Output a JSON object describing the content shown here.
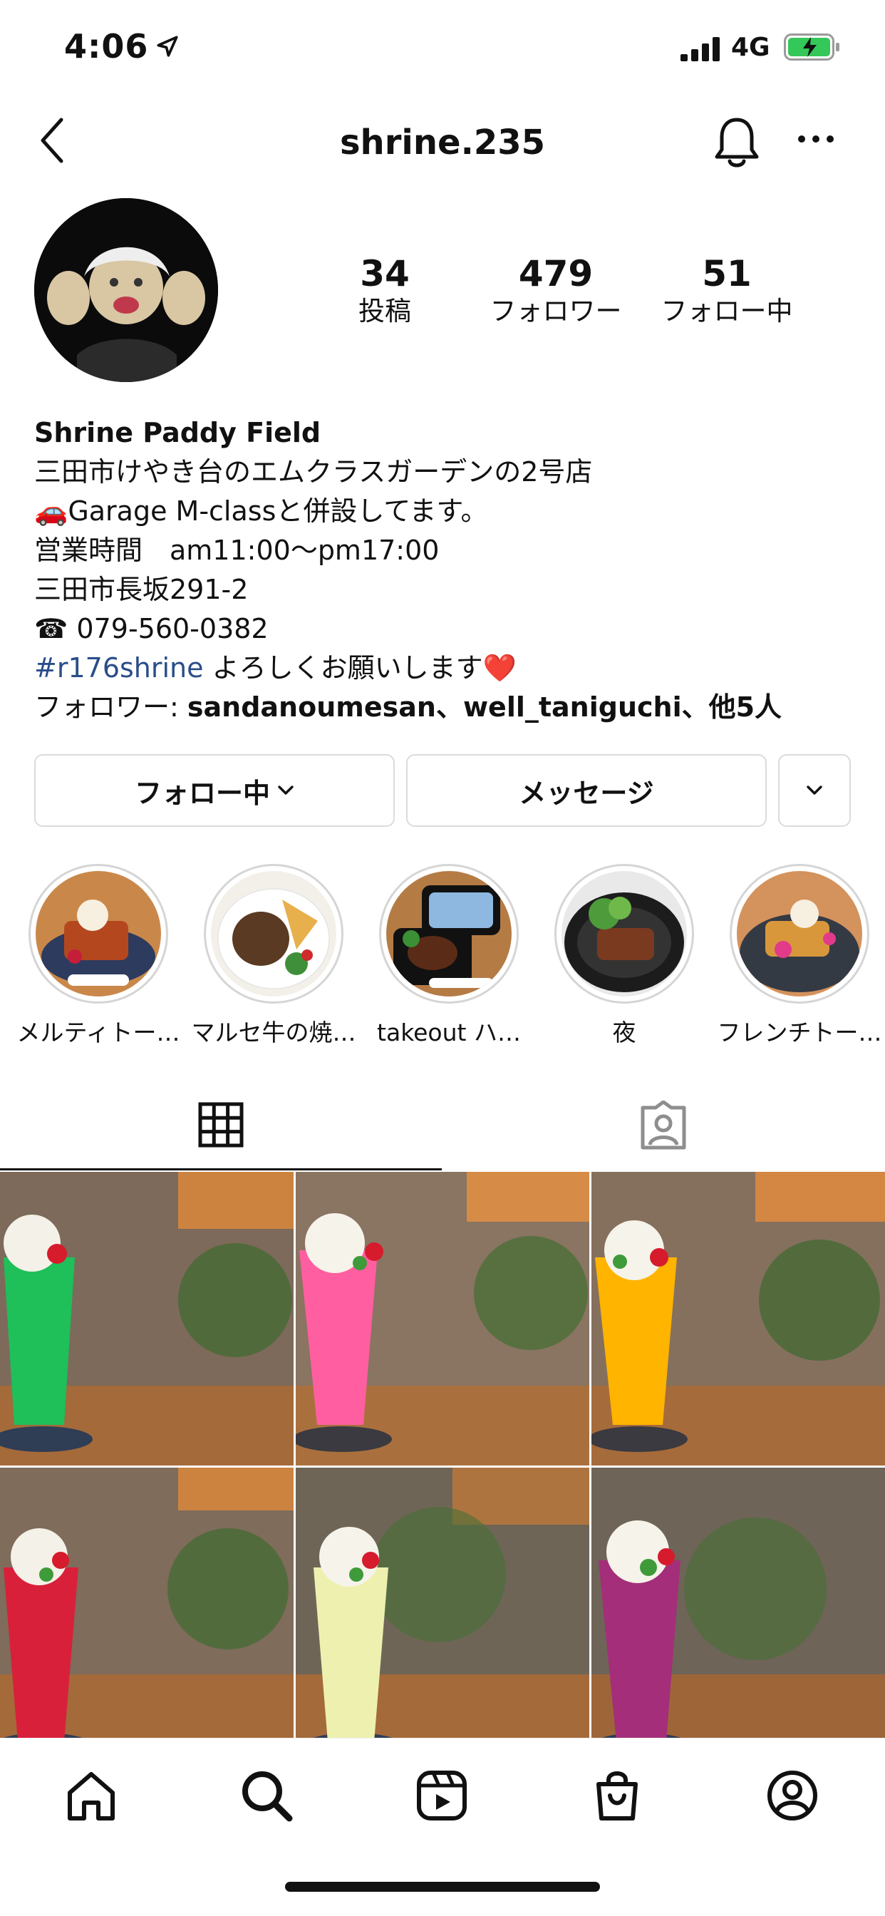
{
  "status_bar": {
    "time": "4:06",
    "network": "4G",
    "icons": [
      "location-arrow-icon",
      "signal-icon",
      "battery-charging-icon"
    ]
  },
  "header": {
    "username": "shrine.235",
    "icons": [
      "back-icon",
      "bell-icon",
      "more-icon"
    ]
  },
  "stats": [
    {
      "value": "34",
      "label": "投稿"
    },
    {
      "value": "479",
      "label": "フォロワー"
    },
    {
      "value": "51",
      "label": "フォロー中"
    }
  ],
  "bio": {
    "name": "Shrine Paddy Field",
    "line1": "三田市けやき台のエムクラスガーデンの2号店",
    "line2": "🚗Garage M-classと併設してます。",
    "line3": "営業時間　am11:00〜pm17:00",
    "line4": "三田市長坂291-2",
    "line5": "☎ 079-560-0382",
    "hashtag": "#r176shrine",
    "line6_rest": " よろしくお願いします❤️",
    "followers_prefix": "フォロワー: ",
    "followers_names": "sandanoumesan、well_taniguchi、他5人"
  },
  "buttons": {
    "following": "フォロー中",
    "message": "メッセージ"
  },
  "highlights": [
    {
      "label": "メルティトー…"
    },
    {
      "label": "マルセ牛の焼…"
    },
    {
      "label": "takeout ハ…"
    },
    {
      "label": "夜"
    },
    {
      "label": "フレンチトー…"
    }
  ],
  "tabs": [
    "grid-icon",
    "tagged-icon"
  ],
  "posts": [
    {
      "drink_color": "#1fbf5a"
    },
    {
      "drink_color": "#ff5fa0"
    },
    {
      "drink_color": "#ffb400"
    },
    {
      "drink_color": "#d8203a"
    },
    {
      "drink_color": "#eef0b0"
    },
    {
      "drink_color": "#a42e7a"
    }
  ],
  "bottom_nav": [
    "home-icon",
    "search-icon",
    "reels-icon",
    "shop-icon",
    "profile-icon"
  ]
}
